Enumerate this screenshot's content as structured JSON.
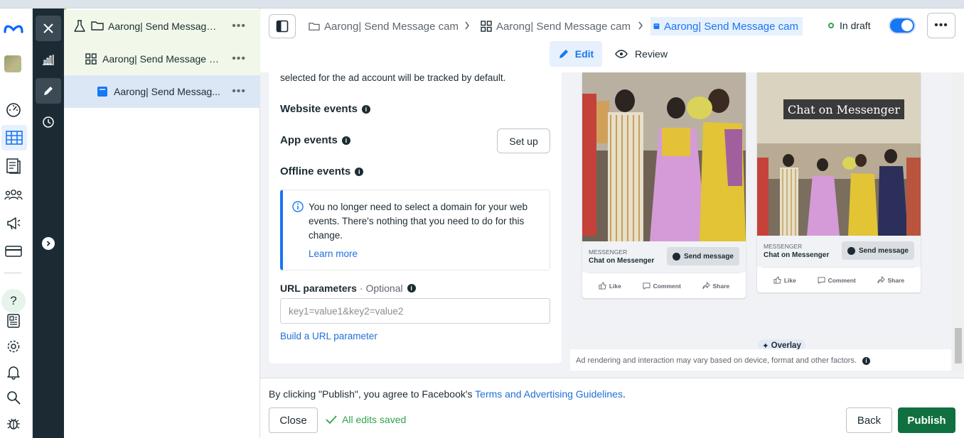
{
  "tree": {
    "items": [
      {
        "label": "Aarong| Send Message ...",
        "icon": "flask-icon",
        "more": "•••"
      },
      {
        "label": "Aarong| Send Message c...",
        "icon": "grid-icon",
        "more": "•••"
      },
      {
        "label": "Aarong| Send Messag...",
        "icon": "ad-icon",
        "more": "•••"
      }
    ]
  },
  "breadcrumb": {
    "campaign": "Aarong| Send Message cam",
    "adset": "Aarong| Send Message cam",
    "ad": "Aarong| Send Message cam"
  },
  "header": {
    "status": "In draft",
    "more": "•••",
    "edit_tab": "Edit",
    "review_tab": "Review"
  },
  "form": {
    "intro": "selected for the ad account will be tracked by default.",
    "website_events": "Website events",
    "app_events": "App events",
    "setup_button": "Set up",
    "offline_events": "Offline events",
    "notice_text": "You no longer need to select a domain for your web events. There's nothing that you need to do for this change.",
    "notice_link": "Learn more",
    "url_params_label": "URL parameters",
    "url_params_optional": "· Optional",
    "url_params_placeholder": "key1=value1&key2=value2",
    "build_link": "Build a URL parameter"
  },
  "preview": {
    "cards": [
      {
        "source": "MESSENGER",
        "headline": "Chat on Messenger",
        "cta": "Send message",
        "like": "Like",
        "comment": "Comment",
        "share": "Share"
      },
      {
        "banner": "Chat on Messenger",
        "source": "MESSENGER",
        "headline": "Chat on Messenger",
        "cta": "Send message",
        "like": "Like",
        "comment": "Comment",
        "share": "Share"
      }
    ],
    "overlay": "Overlay",
    "note": "Ad rendering and interaction may vary based on device, format and other factors."
  },
  "footer": {
    "agree_prefix": "By clicking \"Publish\", you agree to Facebook's ",
    "agree_link": "Terms and Advertising Guidelines",
    "agree_suffix": ".",
    "close": "Close",
    "saved": "All edits saved",
    "back": "Back",
    "publish": "Publish"
  },
  "colors": {
    "accent": "#1877f2",
    "publish": "#11703f",
    "saved": "#31a24c",
    "dark_rail": "#1c2b33"
  }
}
